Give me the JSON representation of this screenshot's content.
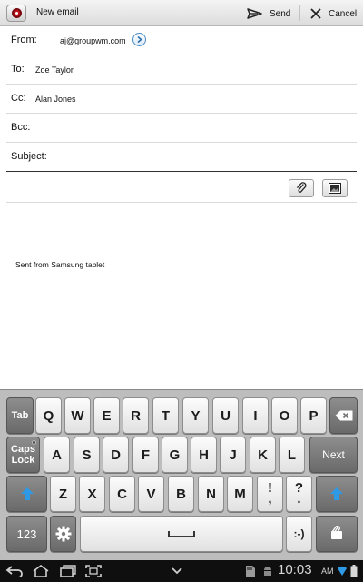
{
  "actionbar": {
    "title": "New email",
    "send_label": "Send",
    "cancel_label": "Cancel"
  },
  "compose": {
    "from_label": "From:",
    "from_value": "aj@groupwm.com",
    "to_label": "To:",
    "to_value": "Zoe Taylor",
    "cc_label": "Cc:",
    "cc_value": "Alan Jones",
    "bcc_label": "Bcc:",
    "bcc_value": "",
    "subject_label": "Subject:",
    "subject_value": "",
    "signature": "Sent from Samsung tablet"
  },
  "keyboard": {
    "row1": [
      "Tab",
      "Q",
      "W",
      "E",
      "R",
      "T",
      "Y",
      "U",
      "I",
      "O",
      "P"
    ],
    "row2_first_line": "Caps",
    "row2_second_line": "Lock",
    "row2": [
      "A",
      "S",
      "D",
      "F",
      "G",
      "H",
      "J",
      "K",
      "L"
    ],
    "next_label": "Next",
    "row3": [
      "Z",
      "X",
      "C",
      "V",
      "B",
      "N",
      "M",
      "!",
      "?"
    ],
    "row3_punct_top": [
      "!",
      "?"
    ],
    "row3_punct_bottom": [
      ",",
      "."
    ],
    "numbers_label": "123",
    "smiley_label": ":-)"
  },
  "statusbar": {
    "time": "10:03",
    "ampm": "AM"
  },
  "colors": {
    "accent_blue": "#2e9ae6",
    "record_red": "#c0111b",
    "keyboard_bg": "#bdbdbd"
  }
}
